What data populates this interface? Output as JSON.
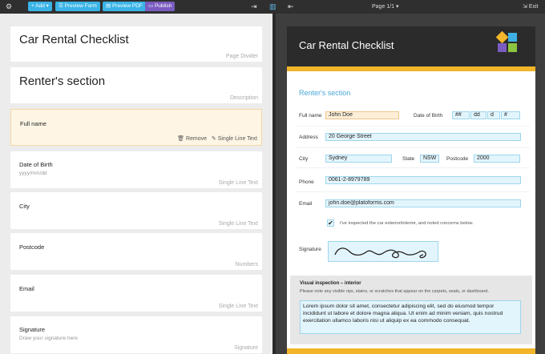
{
  "toolbar": {
    "add_label": "Add",
    "preview_form_label": "Preview Form",
    "preview_pdf_label": "Preview PDF",
    "publish_label": "Publish",
    "page_indicator": "Page 1/1",
    "exit_label": "Exit"
  },
  "builder": {
    "cards": [
      {
        "title": "Car Rental Checklist",
        "type": "Page Divider"
      },
      {
        "title": "Renter's section",
        "type": "Description"
      },
      {
        "title": "Full name",
        "remove_label": "Remove",
        "type": "Single Line Text"
      },
      {
        "title": "Date of Birth",
        "hint": "yyyy/mm/dd",
        "type": "Single Line Text"
      },
      {
        "title": "City",
        "type": "Single Line Text"
      },
      {
        "title": "Postcode",
        "type": "Numbers"
      },
      {
        "title": "Email",
        "type": "Single Line Text"
      },
      {
        "title": "Signature",
        "hint": "Draw your signature here",
        "type": "Signature"
      }
    ]
  },
  "preview": {
    "title": "Car Rental Checklist",
    "section": "Renter's section",
    "full_name_label": "Full name",
    "full_name_value": "John Doe",
    "dob_label": "Date of Birth",
    "dob_parts": [
      "##",
      "dd",
      "d",
      "#"
    ],
    "address_label": "Address",
    "address_value": "20 George Street",
    "city_label": "City",
    "city_value": "Sydney",
    "state_label": "State",
    "state_value": "NSW",
    "postcode_label": "Postcode",
    "postcode_value": "2000",
    "phone_label": "Phone",
    "phone_value": "0061-2-8979789",
    "email_label": "Email",
    "email_value": "john.doe@platoforms.com",
    "check_mark": "✔",
    "check_label": "I've inspected the car exterior/interior, and noted concerns below.",
    "signature_label": "Signature",
    "visual_title": "Visual inspection – interior",
    "visual_desc": "Please note any visible rips, stains, or scratches that appear on the carpets, seats, or dashboard.",
    "visual_text": "Lorem ipsum dolor sit amet, consectetur adipiscing elit, sed do eiusmod tempor incididunt ut labore et dolore magna aliqua. Ut enim ad minim veniam, quis nostrud exercitation ullamco laboris nisi ut aliquip ex ea commodo consequat."
  },
  "colors": {
    "add_button": "#3ab4e6",
    "publish_button": "#7a5cc0",
    "header_band": "#2b2b2b",
    "accent_yellow": "#f2b529",
    "section_blue": "#4aa8d8",
    "field_fill": "#e3f5fc",
    "selected_field": "#fdeed8"
  },
  "icons": {
    "settings": "gear-icon",
    "add": "plus-icon",
    "preview_form": "list-icon",
    "preview_pdf": "document-icon",
    "publish": "monitor-icon",
    "expand": "arrow-right-icon",
    "split_view": "split-view-icon",
    "collapse": "arrow-left-icon",
    "remove": "trash-icon",
    "edit": "pencil-icon",
    "exit": "exit-icon"
  }
}
